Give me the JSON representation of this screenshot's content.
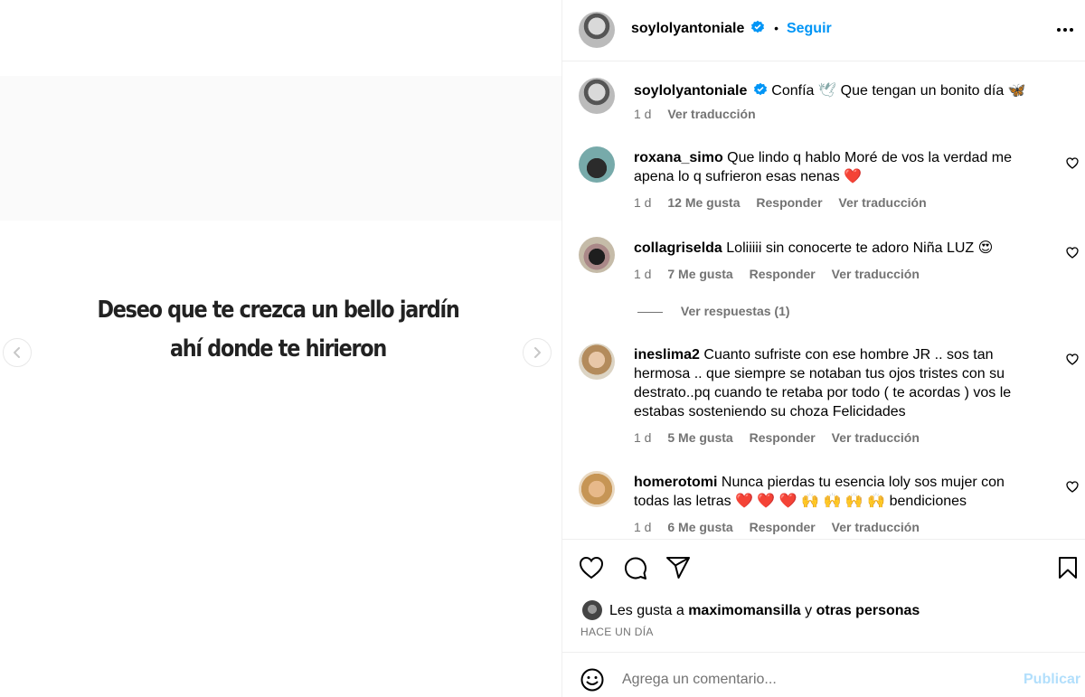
{
  "media": {
    "quote_line1": "Deseo que te crezca un bello jardín",
    "quote_line2": "ahí donde te hirieron"
  },
  "header": {
    "username": "soylolyantoniale",
    "separator": "•",
    "follow_label": "Seguir",
    "more_icon": "more-horizontal-icon"
  },
  "caption": {
    "username": "soylolyantoniale",
    "text_part1": "Confía",
    "emoji1": "🕊",
    "text_part2": "Que tengan un bonito día",
    "emoji2": "🦋",
    "time": "1 d",
    "translate": "Ver traducción"
  },
  "comments": [
    {
      "username": "roxana_simo",
      "text": "Que lindo q hablo Moré de vos la verdad me apena lo q sufrieron esas nenas ❤️",
      "time": "1 d",
      "likes": "12 Me gusta",
      "reply": "Responder",
      "translate": "Ver traducción"
    },
    {
      "username": "collagriselda",
      "text": "Loliiiii sin conocerte te adoro Niña LUZ 😍",
      "time": "1 d",
      "likes": "7 Me gusta",
      "reply": "Responder",
      "translate": "Ver traducción",
      "view_replies": "Ver respuestas (1)"
    },
    {
      "username": "ineslima2",
      "text": "Cuanto sufriste con ese hombre JR .. sos tan hermosa .. que siempre se notaban tus ojos tristes con su destrato..pq cuando te retaba por todo ( te acordas ) vos le estabas sosteniendo su choza Felicidades",
      "time": "1 d",
      "likes": "5 Me gusta",
      "reply": "Responder",
      "translate": "Ver traducción"
    },
    {
      "username": "homerotomi",
      "text": "Nunca pierdas tu esencia loly sos mujer con todas las letras ❤️ ❤️ ❤️ 🙌 🙌 🙌 🙌  bendiciones",
      "time": "1 d",
      "likes": "6 Me gusta",
      "reply": "Responder",
      "translate": "Ver traducción"
    }
  ],
  "likes_line": {
    "prefix": "Les gusta a",
    "user": "maximomansilla",
    "conj": "y",
    "others": "otras personas"
  },
  "timestamp": "HACE UN DÍA",
  "add_comment": {
    "placeholder": "Agrega un comentario...",
    "publish": "Publicar"
  },
  "colors": {
    "accent": "#0095f6",
    "publish_disabled": "#b2dffc",
    "secondary_text": "#737373",
    "border": "#efefef",
    "verified": "#0095f6"
  }
}
